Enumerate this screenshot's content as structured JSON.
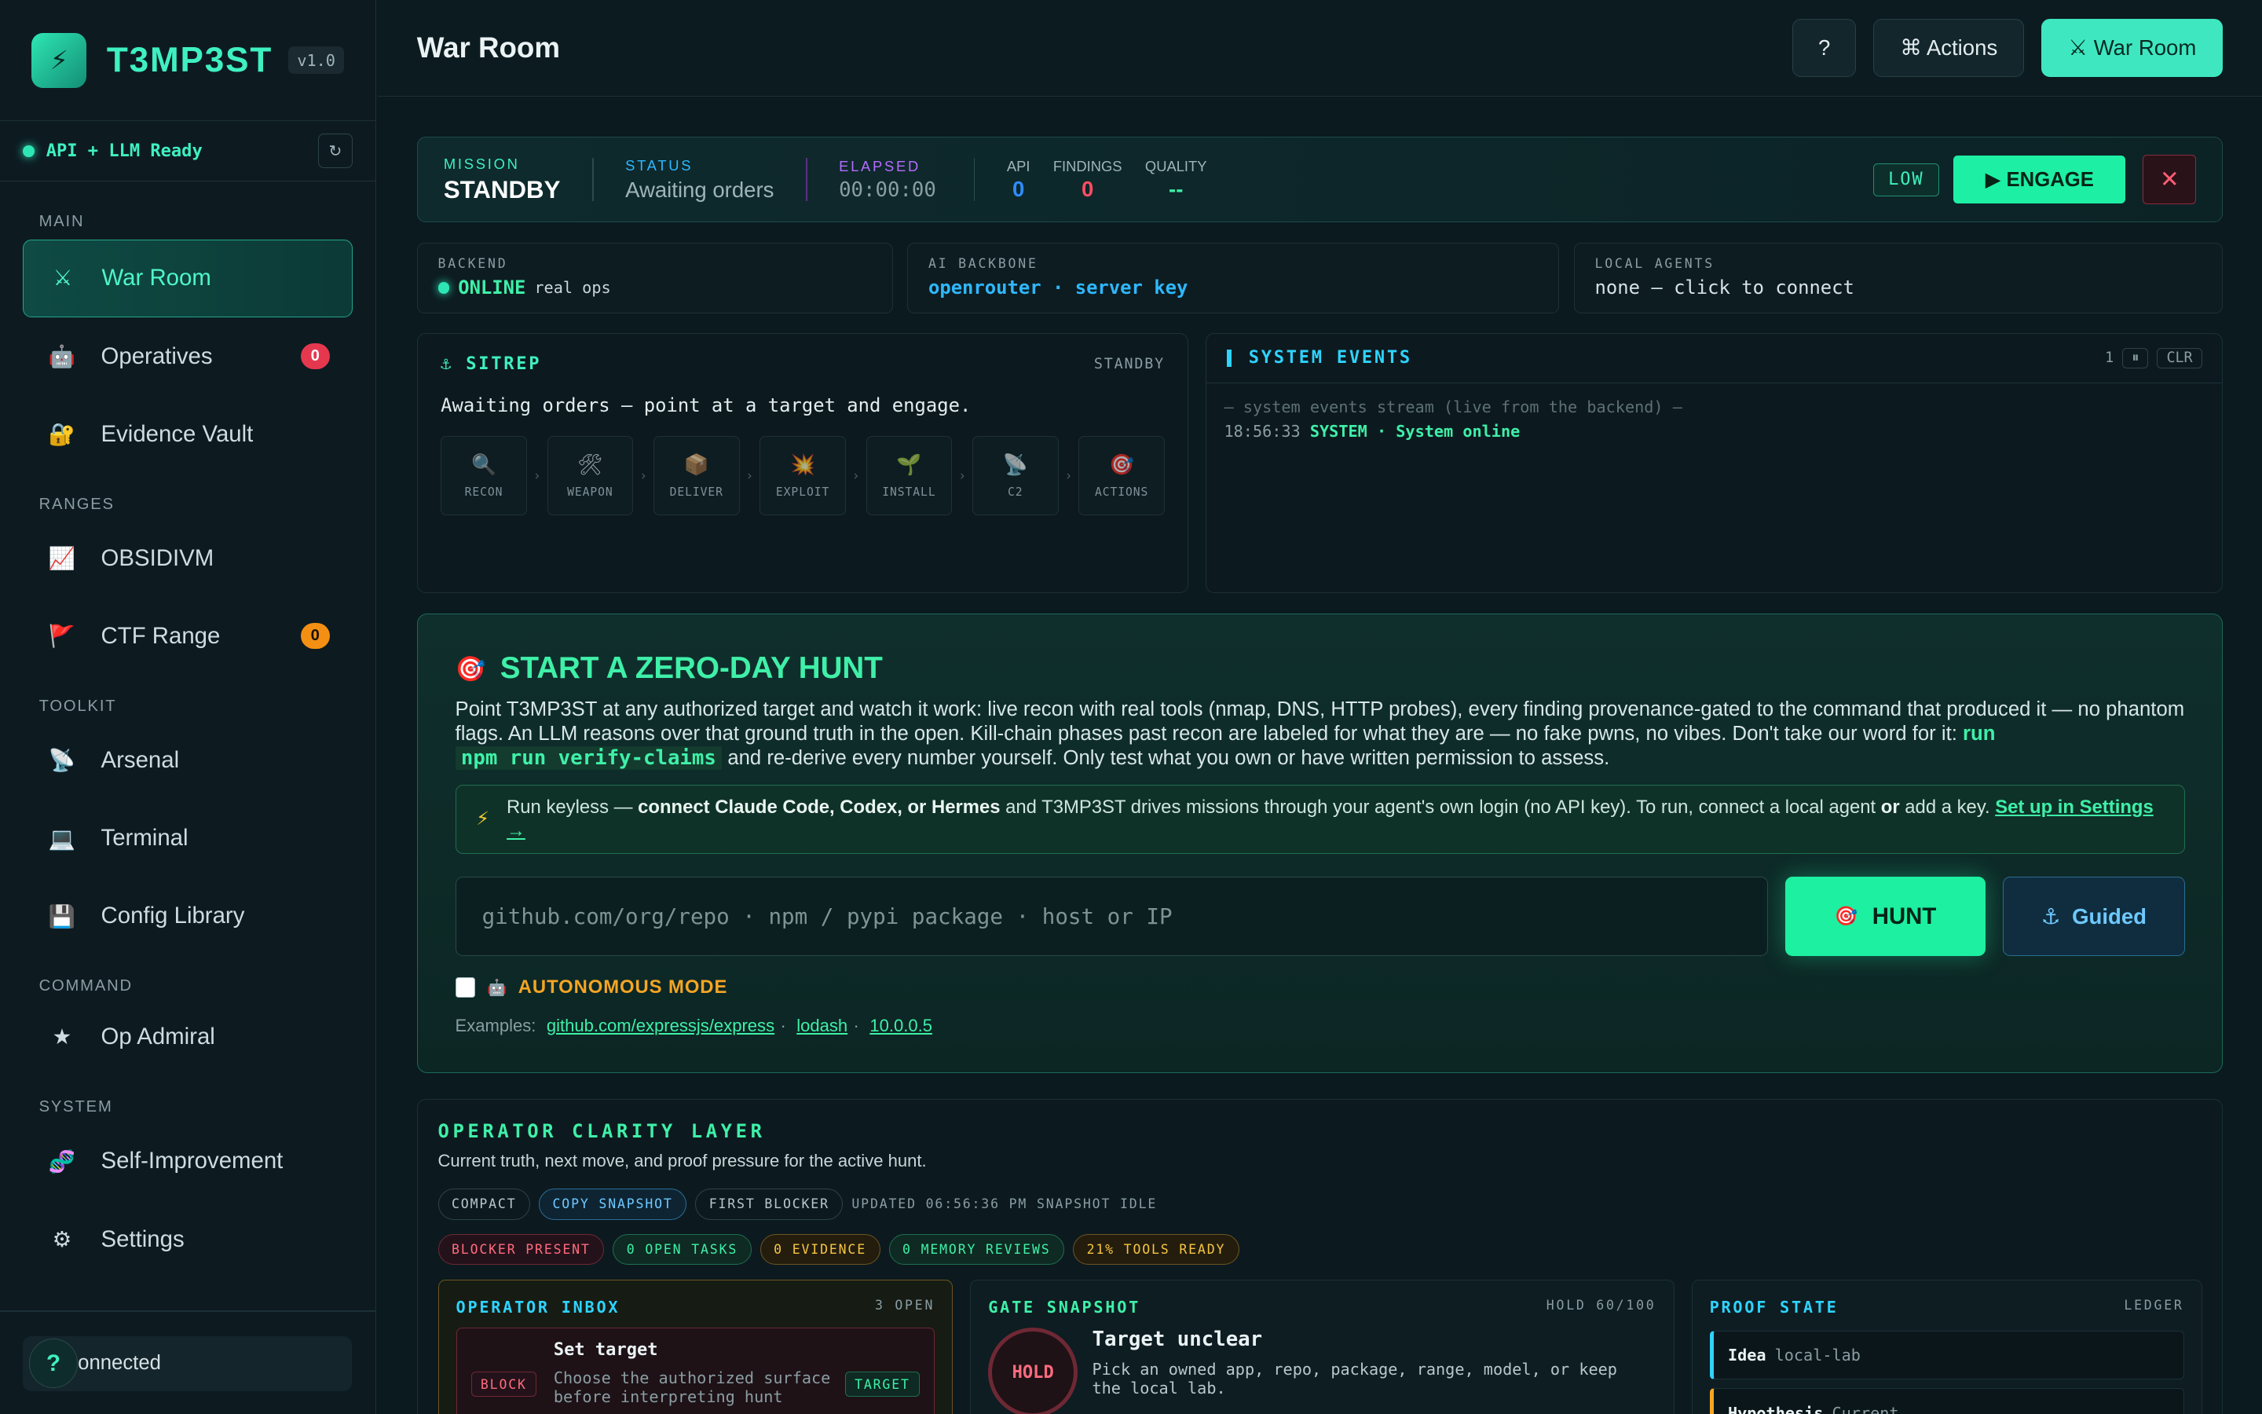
{
  "brand": {
    "name": "T3MP3ST",
    "version": "v1.0"
  },
  "api_status": "API + LLM Ready",
  "nav": {
    "main_label": "MAIN",
    "war_room": "War Room",
    "operatives": "Operatives",
    "operatives_count": "0",
    "evidence_vault": "Evidence Vault",
    "ranges_label": "RANGES",
    "obsidivm": "OBSIDIVM",
    "ctf_range": "CTF Range",
    "ctf_count": "0",
    "toolkit_label": "TOOLKIT",
    "arsenal": "Arsenal",
    "terminal": "Terminal",
    "config_library": "Config Library",
    "command_label": "COMMAND",
    "op_admiral": "Op Admiral",
    "system_label": "SYSTEM",
    "self_improvement": "Self-Improvement",
    "settings": "Settings"
  },
  "footer": {
    "help": "?",
    "connected": "onnected"
  },
  "header": {
    "title": "War Room",
    "help": "?",
    "actions": "⌘ Actions",
    "war_room": "⚔ War Room"
  },
  "mission": {
    "mission_label": "MISSION",
    "mission_value": "STANDBY",
    "status_label": "STATUS",
    "status_value": "Awaiting orders",
    "elapsed_label": "ELAPSED",
    "elapsed_value": "00:00:00",
    "api_label": "API",
    "api_value": "0",
    "findings_label": "FINDINGS",
    "findings_value": "0",
    "quality_label": "QUALITY",
    "quality_value": "--",
    "risk": "LOW",
    "engage": "▶ ENGAGE",
    "close": "✕"
  },
  "info": {
    "backend_label": "BACKEND",
    "backend_status": "ONLINE",
    "backend_mode": "real ops",
    "ai_label": "AI BACKBONE",
    "ai_value": "openrouter · server key",
    "agents_label": "LOCAL AGENTS",
    "agents_value": "none — click to connect"
  },
  "sitrep": {
    "title": "⚓ SITREP",
    "state": "STANDBY",
    "message": "Awaiting orders — point at a target and engage.",
    "phases": [
      "RECON",
      "WEAPON",
      "DELIVER",
      "EXPLOIT",
      "INSTALL",
      "C2",
      "ACTIONS"
    ]
  },
  "events": {
    "title": "SYSTEM EVENTS",
    "count": "1",
    "pause": "⏸",
    "clear": "CLR",
    "stream_note": "— system events stream (live from the backend) —",
    "line_time": "18:56:33",
    "line_source": "SYSTEM · System online"
  },
  "hunt": {
    "title": "START A ZERO-DAY HUNT",
    "desc_1": "Point T3MP3ST at any authorized target and watch it work: live recon with real tools (nmap, DNS, HTTP probes), every finding provenance-gated to the command that produced it — no phantom flags. An LLM reasons over that ground truth in the open. Kill-chain phases past recon are labeled for what they are — no fake pwns, no vibes. Don't take our word for it: ",
    "desc_run": "run",
    "desc_code": "npm run verify-claims",
    "desc_2": " and re-derive every number yourself. Only test what you own or have written permission to assess.",
    "keyless_1": "Run keyless — ",
    "keyless_bold": "connect Claude Code, Codex, or Hermes",
    "keyless_2": " and T3MP3ST drives missions through your agent's own login (no API key). To run, connect a local agent ",
    "keyless_or": "or",
    "keyless_3": " add a key. ",
    "keyless_link": "Set up in Settings →",
    "placeholder": "github.com/org/repo   ·   npm / pypi package   ·   host or IP",
    "hunt_btn": "HUNT",
    "guided_btn": "Guided",
    "autonomous": "AUTONOMOUS MODE",
    "examples_label": "Examples:",
    "examples": [
      "github.com/expressjs/express",
      "lodash",
      "10.0.0.5"
    ]
  },
  "clarity": {
    "title": "OPERATOR CLARITY LAYER",
    "subtitle": "Current truth, next move, and proof pressure for the active hunt.",
    "chips_top": [
      "COMPACT",
      "COPY SNAPSHOT",
      "FIRST BLOCKER"
    ],
    "updated": "UPDATED 06:56:36 PM SNAPSHOT IDLE",
    "chips_status": [
      "BLOCKER PRESENT",
      "0 OPEN TASKS",
      "0 EVIDENCE",
      "0 MEMORY REVIEWS",
      "21% TOOLS READY"
    ],
    "inbox_title": "OPERATOR INBOX",
    "inbox_count": "3 OPEN",
    "inbox_item_title": "Set target",
    "inbox_item_desc": "Choose the authorized surface before interpreting hunt",
    "inbox_block": "BLOCK",
    "inbox_target": "TARGET",
    "gate_title": "GATE SNAPSHOT",
    "gate_hold": "HOLD 60/100",
    "gate_badge": "HOLD",
    "gate_heading": "Target unclear",
    "gate_desc": "Pick an owned app, repo, package, range, model, or keep the local lab.",
    "proof_title": "PROOF STATE",
    "proof_ledger": "LEDGER",
    "proof_idea": "Idea",
    "proof_idea_val": "local-lab",
    "proof_hyp": "Hypothesis",
    "proof_hyp_val": "Current"
  }
}
